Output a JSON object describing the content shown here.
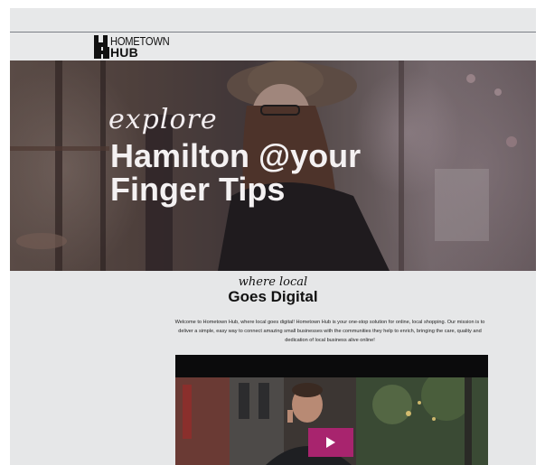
{
  "brand": {
    "name_line1": "HOMETOWN",
    "name_line2": "HUB"
  },
  "hero": {
    "script_text": "explore",
    "title_line1": "Hamilton @your",
    "title_line2": "Finger Tips"
  },
  "section": {
    "script_text": "where local",
    "title": "Goes Digital",
    "intro": "Welcome to Hometown Hub, where local goes digital! Hometown Hub is your one-stop solution for online, local shopping. Our mission is to deliver a simple, easy way to connect amazing small businesses with the communities they help to enrich, bringing the care, quality and dedication of local business alive online!"
  },
  "video": {
    "play_icon": "play-icon",
    "accent": "#a8246e"
  }
}
